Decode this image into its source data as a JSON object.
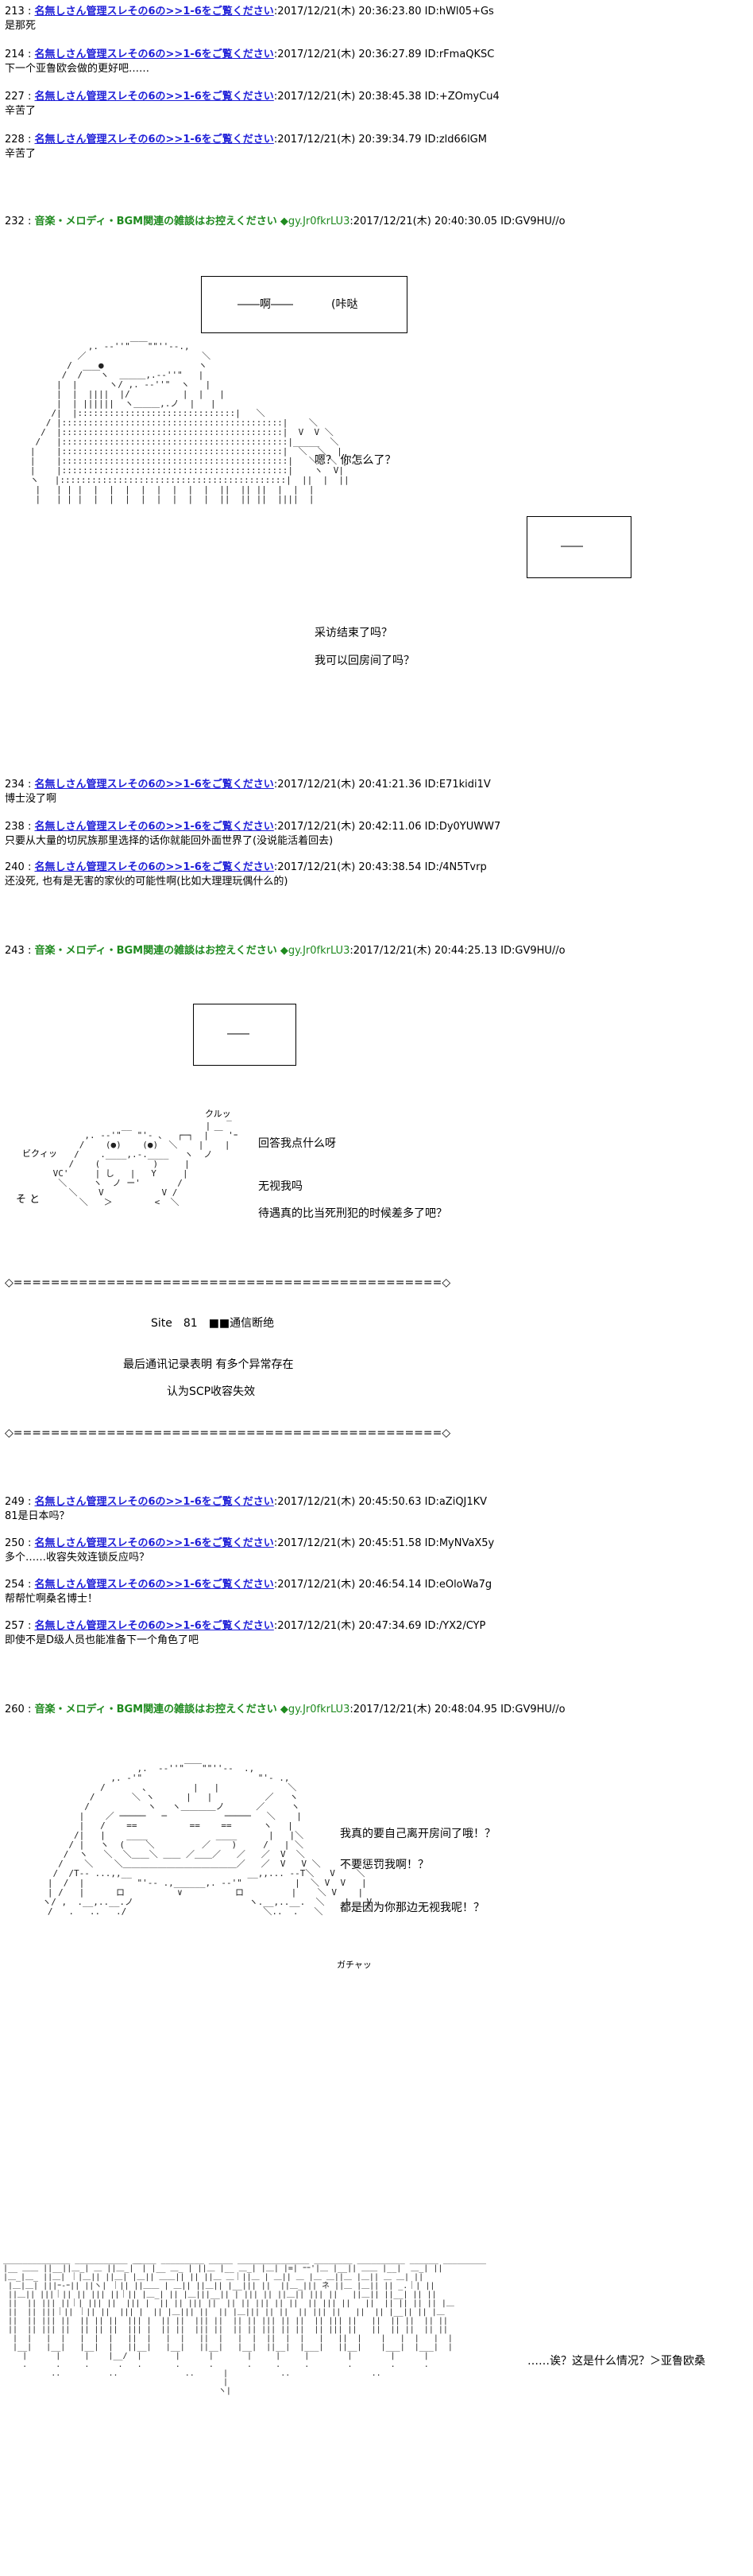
{
  "posts": [
    {
      "num": "213",
      "name": "名無しさん管理スレその6の>>1-6をご覧ください",
      "date": "2017/12/21(木) 20:36:23.80",
      "id": "ID:hWl05+Gs",
      "body": [
        "是那死"
      ]
    },
    {
      "num": "214",
      "name": "名無しさん管理スレその6の>>1-6をご覧ください",
      "date": "2017/12/21(木) 20:36:27.89",
      "id": "ID:rFmaQKSC",
      "body": [
        "下一个亚鲁欧会做的更好吧……"
      ]
    },
    {
      "num": "227",
      "name": "名無しさん管理スレその6の>>1-6をご覧ください",
      "date": "2017/12/21(木) 20:38:45.38",
      "id": "ID:+ZOmyCu4",
      "body": [
        "辛苦了"
      ]
    },
    {
      "num": "228",
      "name": "名無しさん管理スレその6の>>1-6をご覧ください",
      "date": "2017/12/21(木) 20:39:34.79",
      "id": "ID:zld66lGM",
      "body": [
        "辛苦了"
      ]
    },
    {
      "num": "232",
      "gname": "音楽・メロディ・BGM関連の雑談はお控えください",
      "trip": "◆gy.Jr0fkrLU3",
      "date": ":2017/12/21(木) 20:40:30.05",
      "id": "ID:GV9HU//o"
    },
    {
      "num": "234",
      "name": "名無しさん管理スレその6の>>1-6をご覧ください",
      "date": "2017/12/21(木) 20:41:21.36",
      "id": "ID:E71kidi1V",
      "body": [
        "博士没了啊"
      ]
    },
    {
      "num": "238",
      "name": "名無しさん管理スレその6の>>1-6をご覧ください",
      "date": "2017/12/21(木) 20:42:11.06",
      "id": "ID:Dy0YUWW7",
      "body": [
        "只要从大量的切尻族那里选择的话你就能回外面世界了(没说能活着回去)"
      ]
    },
    {
      "num": "240",
      "name": "名無しさん管理スレその6の>>1-6をご覧ください",
      "date": "2017/12/21(木) 20:43:38.54",
      "id": "ID:/4N5Tvrp",
      "body": [
        "还没死, 也有是无害的家伙的可能性啊(比如大理理玩偶什么的)"
      ]
    },
    {
      "num": "243",
      "gname": "音楽・メロディ・BGM関連の雑談はお控えください",
      "trip": "◆gy.Jr0fkrLU3",
      "date": ":2017/12/21(木) 20:44:25.13",
      "id": "ID:GV9HU//o"
    },
    {
      "num": "249",
      "name": "名無しさん管理スレその6の>>1-6をご覧ください",
      "date": "2017/12/21(木) 20:45:50.63",
      "id": "ID:aZiQJ1KV",
      "body": [
        "81是日本吗？"
      ]
    },
    {
      "num": "250",
      "name": "名無しさん管理スレその6の>>1-6をご覧ください",
      "date": "2017/12/21(木) 20:45:51.58",
      "id": "ID:MyNVaX5y",
      "body": [
        "多个……收容失效连锁反应吗？"
      ]
    },
    {
      "num": "254",
      "name": "名無しさん管理スレその6の>>1-6をご覧ください",
      "date": "2017/12/21(木) 20:46:54.14",
      "id": "ID:eOloWa7g",
      "body": [
        "帮帮忙啊桑名博士！"
      ]
    },
    {
      "num": "257",
      "name": "名無しさん管理スレその6の>>1-6をご覧ください",
      "date": "2017/12/21(木) 20:47:34.69",
      "id": "ID:/YX2/CYP",
      "body": [
        "即使不是D级人员也能准备下一个角色了吧"
      ]
    },
    {
      "num": "260",
      "gname": "音楽・メロディ・BGM関連の雑談はお控えください",
      "trip": "◆gy.Jr0fkrLU3",
      "date": ":2017/12/21(木) 20:48:04.95",
      "id": "ID:GV9HU//o"
    }
  ],
  "scene1": {
    "box_text_a": "――啊――",
    "box_text_b": "(咔哒",
    "box2_text": "――",
    "line1": "嗯？ 你怎么了？",
    "line2": "采访结束了吗？",
    "line3": "我可以回房间了吗？"
  },
  "scene2": {
    "box_text": "――",
    "sfx_kurutsu": "クルッ",
    "sfx_bikui": "ビクィッ",
    "sfx_soto": "そ と",
    "line1": "回答我点什么呀",
    "line2": "无视我吗",
    "line3": "待遇真的比当死刑犯的时候差多了吧？"
  },
  "notice": {
    "divider": "◇==============================================◇",
    "line1": "Site　81　■■通信断绝",
    "line2": "最后通讯记录表明 有多个异常存在",
    "line3": "认为SCP收容失效"
  },
  "scene3": {
    "line1": "我真的要自己离开房间了哦！？",
    "line2": "不要惩罚我啊！？",
    "line3": "都是因为你那边无视我呢！？",
    "sfx": "ガチャッ"
  },
  "scene4": {
    "line1": "……诶？这是什么情况？＞亚鲁欧桑"
  }
}
